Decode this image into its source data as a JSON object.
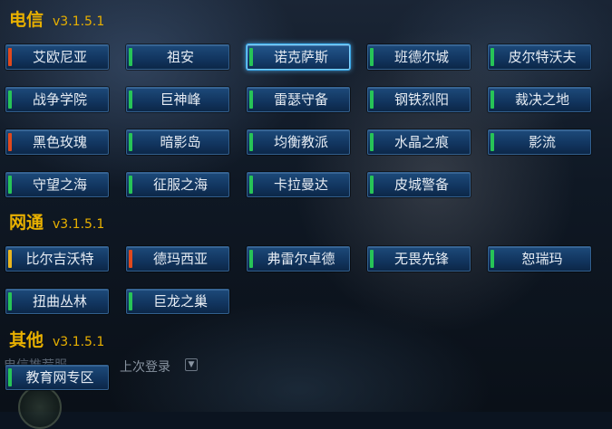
{
  "colors": {
    "ok": "#27c457",
    "busy": "#e0491d",
    "warn": "#e9b51f"
  },
  "sections": [
    {
      "title": "电信",
      "version": "v3.1.5.1",
      "servers": [
        {
          "name": "艾欧尼亚",
          "status": "busy"
        },
        {
          "name": "祖安",
          "status": "ok"
        },
        {
          "name": "诺克萨斯",
          "status": "ok",
          "selected": true
        },
        {
          "name": "班德尔城",
          "status": "ok"
        },
        {
          "name": "皮尔特沃夫",
          "status": "ok"
        },
        {
          "name": "战争学院",
          "status": "ok"
        },
        {
          "name": "巨神峰",
          "status": "ok"
        },
        {
          "name": "雷瑟守备",
          "status": "ok"
        },
        {
          "name": "钢铁烈阳",
          "status": "ok"
        },
        {
          "name": "裁决之地",
          "status": "ok"
        },
        {
          "name": "黑色玫瑰",
          "status": "busy"
        },
        {
          "name": "暗影岛",
          "status": "ok"
        },
        {
          "name": "均衡教派",
          "status": "ok"
        },
        {
          "name": "水晶之痕",
          "status": "ok"
        },
        {
          "name": "影流",
          "status": "ok"
        },
        {
          "name": "守望之海",
          "status": "ok"
        },
        {
          "name": "征服之海",
          "status": "ok"
        },
        {
          "name": "卡拉曼达",
          "status": "ok"
        },
        {
          "name": "皮城警备",
          "status": "ok"
        }
      ]
    },
    {
      "title": "网通",
      "version": "v3.1.5.1",
      "servers": [
        {
          "name": "比尔吉沃特",
          "status": "warn"
        },
        {
          "name": "德玛西亚",
          "status": "busy"
        },
        {
          "name": "弗雷尔卓德",
          "status": "ok"
        },
        {
          "name": "无畏先锋",
          "status": "ok"
        },
        {
          "name": "恕瑞玛",
          "status": "ok"
        },
        {
          "name": "扭曲丛林",
          "status": "ok"
        },
        {
          "name": "巨龙之巢",
          "status": "ok"
        }
      ]
    },
    {
      "title": "其他",
      "version": "v3.1.5.1",
      "servers": [
        {
          "name": "教育网专区",
          "status": "ok"
        }
      ]
    }
  ],
  "footer": {
    "recommended": "电信推荐服",
    "last_login": "上次登录"
  }
}
